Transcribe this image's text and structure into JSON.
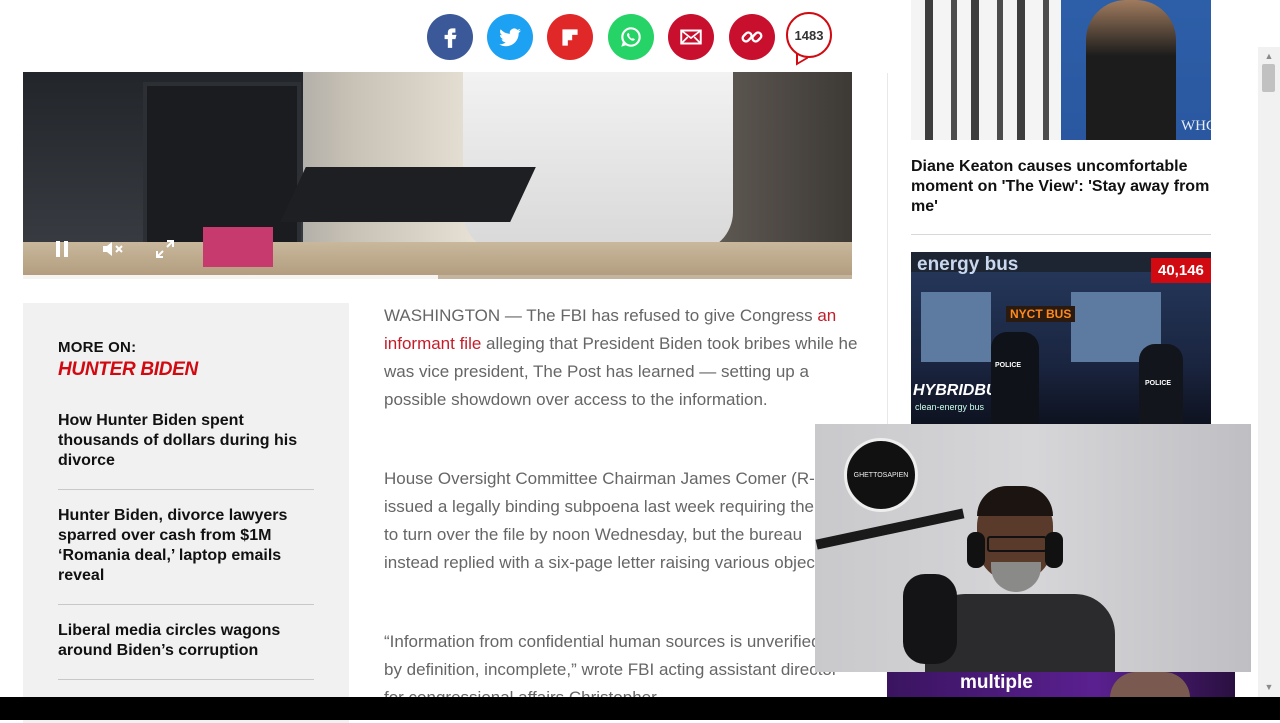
{
  "share": {
    "buttons": [
      {
        "name": "facebook",
        "color": "#3b5998",
        "icon": "facebook-icon"
      },
      {
        "name": "twitter",
        "color": "#1da1f2",
        "icon": "twitter-icon"
      },
      {
        "name": "flipboard",
        "color": "#e12828",
        "icon": "flipboard-icon"
      },
      {
        "name": "whatsapp",
        "color": "#25d366",
        "icon": "whatsapp-icon"
      },
      {
        "name": "email",
        "color": "#c8102e",
        "icon": "email-icon"
      },
      {
        "name": "copy-link",
        "color": "#c8102e",
        "icon": "link-icon"
      }
    ],
    "comment_count": "1483"
  },
  "video": {
    "progress_fraction": 0.5
  },
  "more_on": {
    "label": "MORE ON:",
    "topic": "HUNTER BIDEN",
    "items": [
      "How Hunter Biden spent thousands of dollars during his divorce",
      "Hunter Biden, divorce lawyers sparred over cash from $1M ‘Romania deal,’ laptop emails reveal",
      "Liberal media circles wagons around Biden’s corruption"
    ]
  },
  "article": {
    "p1_before": "WASHINGTON — The FBI has refused to give Congress ",
    "p1_link": "an informant file",
    "p1_after": " alleging that President Biden took bribes while he was vice president, The Post has learned — setting up a possible showdown over access to the information.",
    "p2": "House Oversight Committee Chairman James Comer (R-Ky.) issued a legally binding subpoena last week requiring the FBI to turn over the file by noon Wednesday, but the bureau instead replied with a six-page letter raising various objections.",
    "p3": "“Information from confidential human sources is unverified and, by definition, incomplete,” wrote FBI acting assistant director for congressional affairs Christopher"
  },
  "sidebar": {
    "story1_headline": "Diane Keaton causes uncomfortable moment on 'The View': 'Stay away from me'",
    "story1_image_text": "WHC",
    "story2_count": "40,146",
    "story2_image_top_text": "energy bus",
    "story2_image_sign": "NYCT BUS",
    "story2_image_side_text": "HYBRIDBUS",
    "story2_image_side_sub": "clean-energy bus",
    "police_label": "POLICE"
  },
  "webcam": {
    "logo_text": "GHETTOSAPIEN"
  },
  "ad": {
    "text": "multiple"
  },
  "colors": {
    "brand_red": "#d10a11",
    "article_text": "#666666",
    "link_red": "#c41d2a"
  }
}
